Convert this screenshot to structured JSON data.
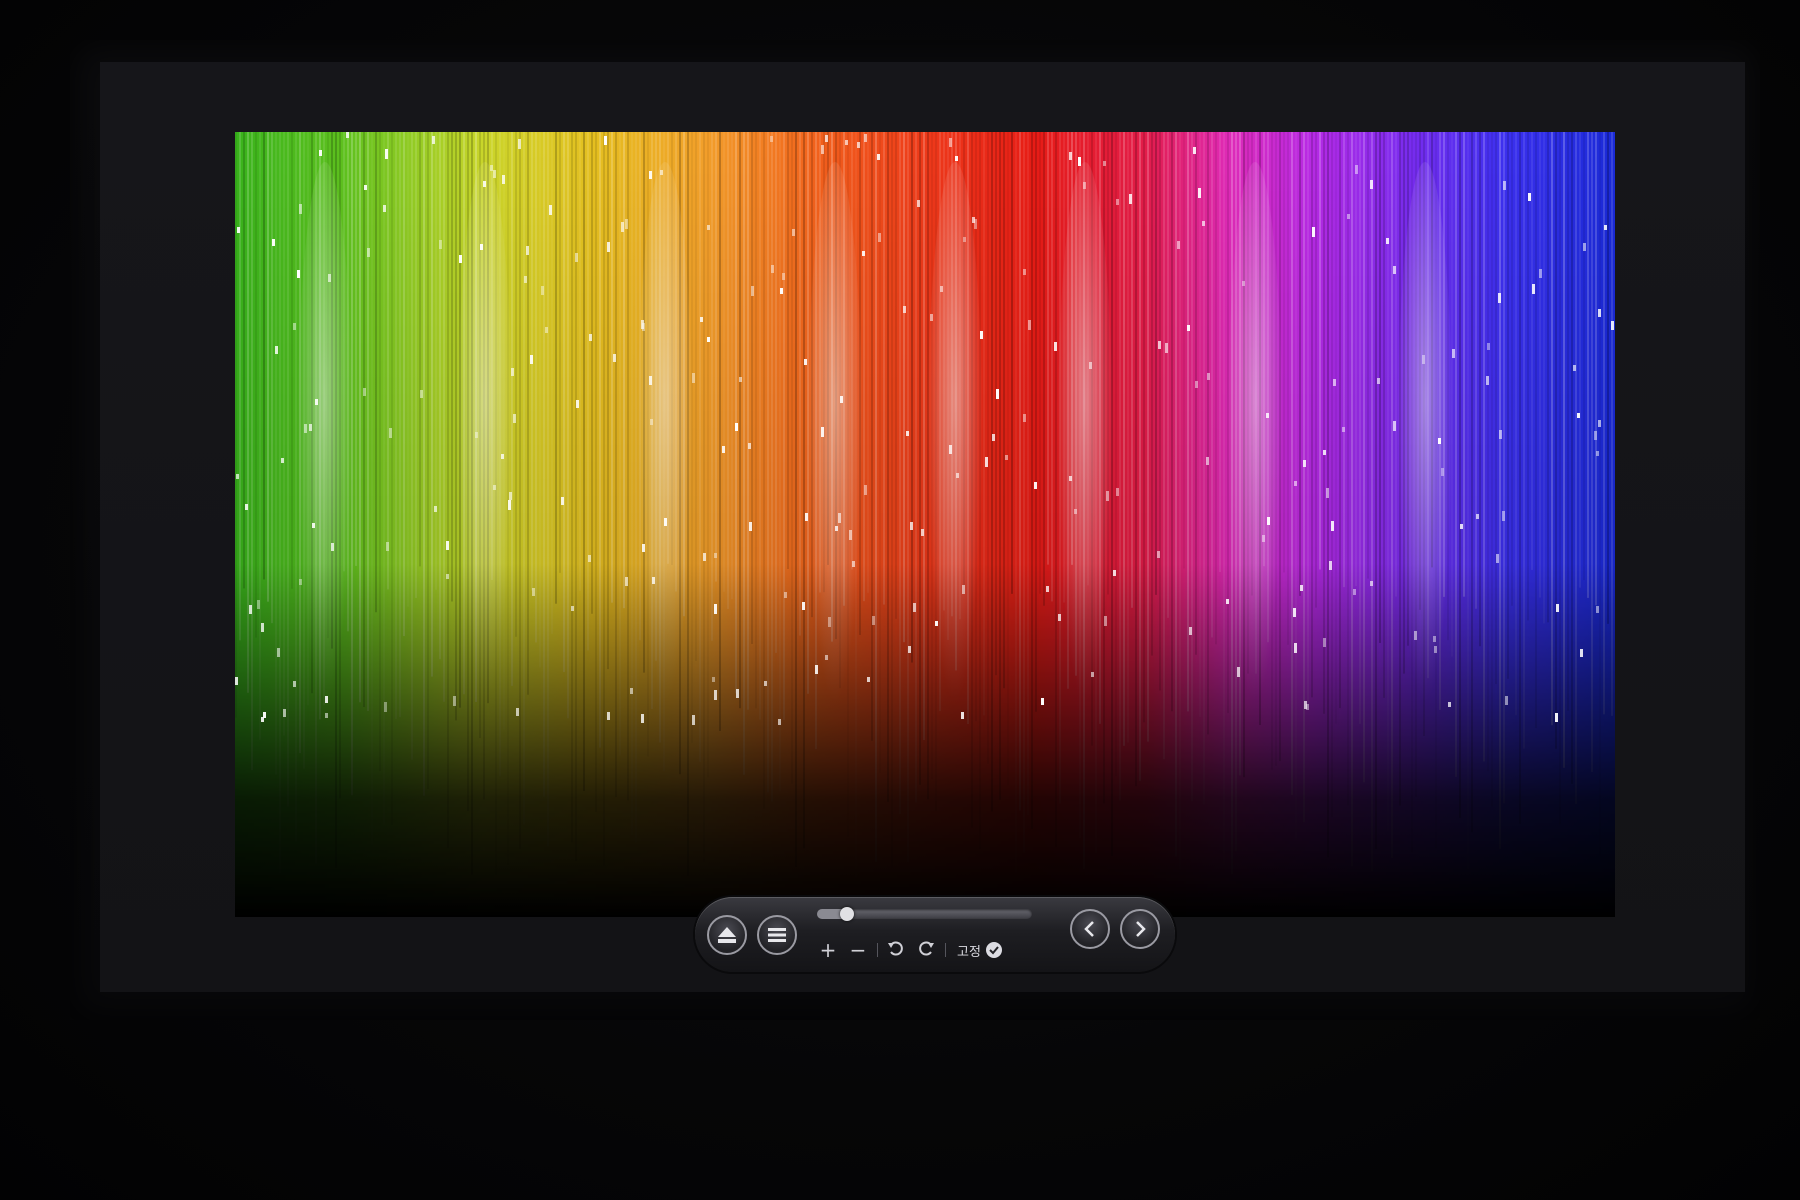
{
  "viewer": {
    "photo_description_icon": "spectrum-wallpaper",
    "toolbar": {
      "eject_icon": "eject-icon",
      "menu_icon": "menu-icon",
      "zoom_in_label": "+",
      "zoom_out_label": "−",
      "rotate_left_icon": "rotate-left-icon",
      "rotate_right_icon": "rotate-right-icon",
      "pin_label": "고정",
      "pin_checked": true,
      "prev_icon": "chevron-left-icon",
      "next_icon": "chevron-right-icon",
      "zoom_slider_value": 0.14
    }
  },
  "colors": {
    "toolbar_bg": "#1e1e22",
    "button_ring": "#9a9aa2",
    "icon": "#e8e8ec"
  }
}
